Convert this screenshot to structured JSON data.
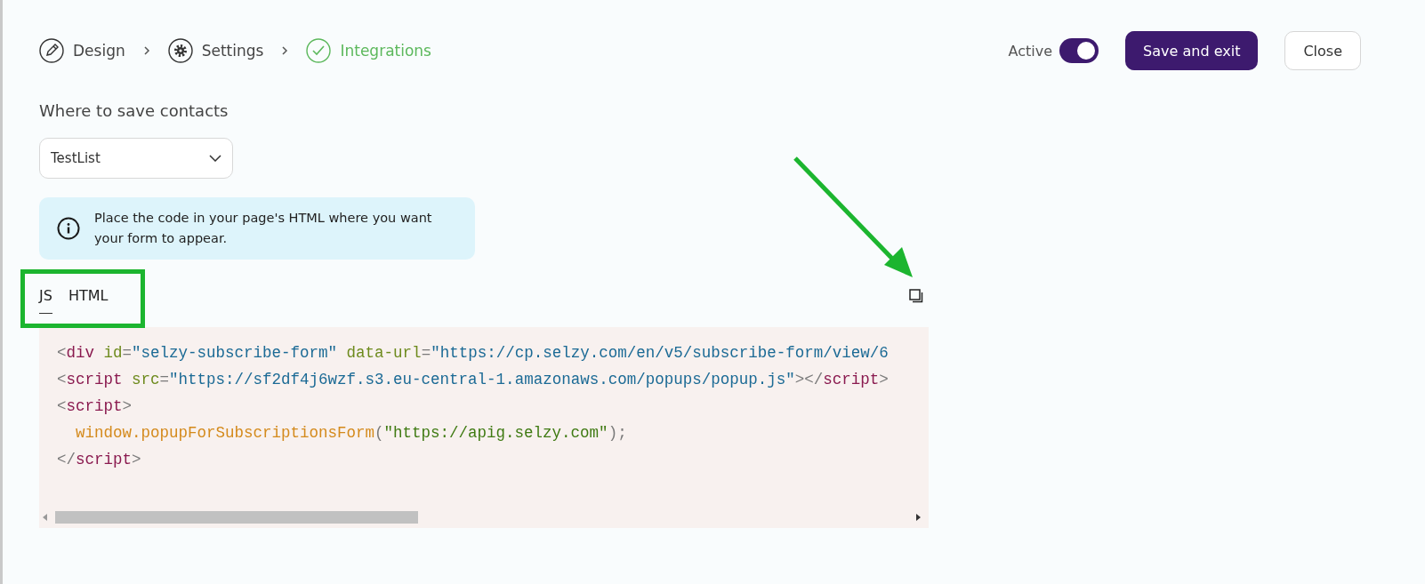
{
  "steps": [
    {
      "label": "Design",
      "selected": false
    },
    {
      "label": "Settings",
      "selected": false
    },
    {
      "label": "Integrations",
      "selected": true
    }
  ],
  "header": {
    "toggle_label": "Active",
    "active": true,
    "save_button": "Save and exit",
    "close_button": "Close"
  },
  "list_section": {
    "title": "Where to save contacts",
    "dropdown_value": "TestList"
  },
  "info_note": "Place the code in your page's HTML where you want your form to appear.",
  "code_tabs": [
    {
      "label": "JS",
      "selected": true
    },
    {
      "label": "HTML",
      "selected": false
    }
  ],
  "code_lines": [
    [
      {
        "kind": "punct",
        "text": "<"
      },
      {
        "kind": "tag",
        "text": "div"
      },
      {
        "kind": "attr",
        "text": " id"
      },
      {
        "kind": "punct",
        "text": "="
      },
      {
        "kind": "string",
        "text": "\"selzy-subscribe-form\""
      },
      {
        "kind": "attr",
        "text": " data-url"
      },
      {
        "kind": "punct",
        "text": "="
      },
      {
        "kind": "string",
        "text": "\"https://cp.selzy.com/en/v5/subscribe-form/view/6"
      }
    ],
    [
      {
        "kind": "punct",
        "text": "<"
      },
      {
        "kind": "tag",
        "text": "script"
      },
      {
        "kind": "attr",
        "text": " src"
      },
      {
        "kind": "punct",
        "text": "="
      },
      {
        "kind": "string",
        "text": "\"https://sf2df4j6wzf.s3.eu-central-1.amazonaws.com/popups/popup.js\""
      },
      {
        "kind": "punct",
        "text": "></"
      },
      {
        "kind": "tag",
        "text": "script"
      },
      {
        "kind": "punct",
        "text": ">"
      }
    ],
    [
      {
        "kind": "punct",
        "text": "<"
      },
      {
        "kind": "tag",
        "text": "script"
      },
      {
        "kind": "punct",
        "text": ">"
      }
    ],
    [
      {
        "kind": "func",
        "text": "  window.popupForSubscriptionsForm"
      },
      {
        "kind": "punct",
        "text": "("
      },
      {
        "kind": "arg",
        "text": "\"https://apig.selzy.com\""
      },
      {
        "kind": "punct",
        "text": ");"
      }
    ],
    [
      {
        "kind": "punct",
        "text": "</"
      },
      {
        "kind": "tag",
        "text": "script"
      },
      {
        "kind": "punct",
        "text": ">"
      }
    ]
  ]
}
